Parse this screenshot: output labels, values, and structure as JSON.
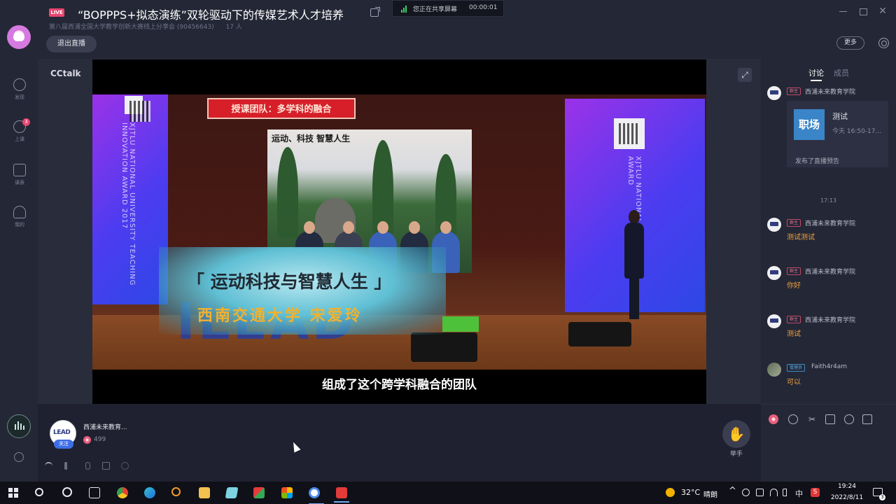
{
  "titlebar": {
    "live_badge": "LIVE",
    "room_title": "“BOPPPS+拟态演练”双轮驱动下的传媒艺术人才培养",
    "room_subtitle": "第八届西浦全国大学教学创新大赛线上分享会 (90456643)",
    "viewer_count": "17 人",
    "exit_live": "退出直播",
    "more": "更多",
    "close_glyph": "✕"
  },
  "share_banner": {
    "text": "您正在共享屏幕",
    "timer": "00:00:01"
  },
  "left_nav": {
    "items": [
      {
        "label": "发现",
        "icon": "compass-icon"
      },
      {
        "label": "上课",
        "icon": "class-icon",
        "badge": "3"
      },
      {
        "label": "课表",
        "icon": "calendar-check-icon"
      },
      {
        "label": "我的",
        "icon": "user-icon"
      }
    ]
  },
  "stage": {
    "brand": "CCtalk",
    "expand_glyph": "⤢",
    "video": {
      "red_tag": "授课团队：多学科的融合",
      "main_screen_title": "运动、科技 智慧人生",
      "overlay_title": "「 运动科技与智慧人生 」",
      "overlay_subtitle": "西南交通大学 宋爱玲",
      "stage_letters": "ILEAD",
      "left_vertical_text": "XJTLU NATIONAL UNIVERSITY TEACHING INNOVATION AWARD 2017",
      "right_vertical_text": "XJTLU NATIONAL INNOVATION AWARD",
      "caption": "组成了这个跨学科融合的团队"
    }
  },
  "right_panel": {
    "tabs": [
      "讨论",
      "成员"
    ],
    "preview_card": {
      "thumb_text": "职场",
      "title": "测试",
      "time": "今天 16:50-17...",
      "note": "发布了直播预告"
    },
    "preview_author": {
      "role": "群主",
      "author": "西浦未来教育学院"
    },
    "time_divider": "17:13",
    "messages": [
      {
        "role": "群主",
        "author": "西浦未来教育学院",
        "text": "测试测试"
      },
      {
        "role": "群主",
        "author": "西浦未来教育学院",
        "text": "你好"
      },
      {
        "role": "群主",
        "author": "西浦未来教育学院",
        "text": "测试"
      },
      {
        "role": "管理员",
        "author": "Faith4r4am",
        "text": "可以"
      }
    ]
  },
  "bottom": {
    "host_name": "西浦未来教育...",
    "host_logo": "LEAD",
    "follow": "关注",
    "flower_count": "499",
    "raise_hand_glyph": "✋",
    "raise_hand_label": "举手",
    "scissors_glyph": "✂"
  },
  "taskbar": {
    "weather_temp": "32°C",
    "weather_cond": "晴朗",
    "chevron": "^",
    "ime": "中",
    "sogou": "S",
    "time": "19:24",
    "date": "2022/8/11",
    "notifications": "3"
  },
  "colors": {
    "accent_live": "#e8456f",
    "chat_text": "#f0a23e",
    "follow_blue": "#3d6ee8",
    "panel_bg": "#242736"
  }
}
